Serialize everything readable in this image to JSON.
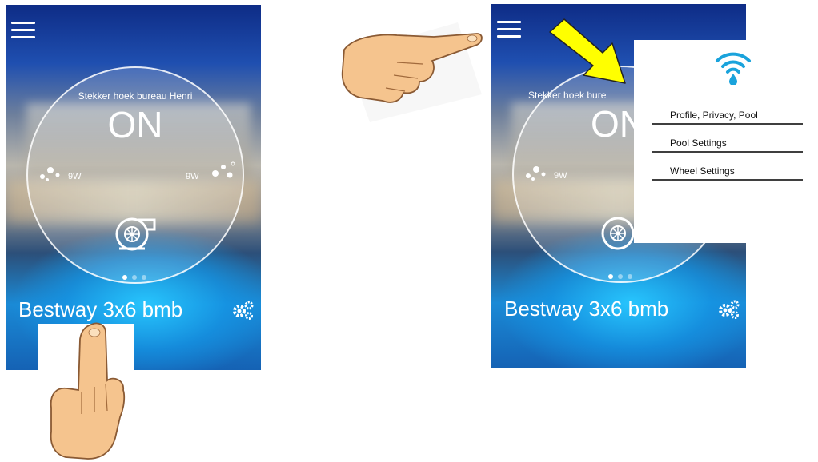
{
  "left_screen": {
    "device_label": "Stekker hoek bureau Henri",
    "state": "ON",
    "watts_left": "9W",
    "watts_right": "9W",
    "pool_name": "Bestway 3x6 bmb"
  },
  "right_screen": {
    "device_label": "Stekker hoek bure",
    "state": "ON",
    "watts_left": "9W",
    "pool_name": "Bestway 3x6 bmb",
    "menu": {
      "items": [
        {
          "label": "Profile, Privacy, Pool"
        },
        {
          "label": "Pool Settings"
        },
        {
          "label": "Wheel Settings"
        }
      ]
    }
  },
  "colors": {
    "accent": "#1aa3dc",
    "arrow": "#ffff00",
    "hand": "#f5c48e"
  },
  "icons": [
    "menu-icon",
    "bubbles-icon",
    "pump-icon",
    "gears-icon",
    "wifi-drop-icon",
    "pointing-hand-icon",
    "arrow-icon"
  ]
}
